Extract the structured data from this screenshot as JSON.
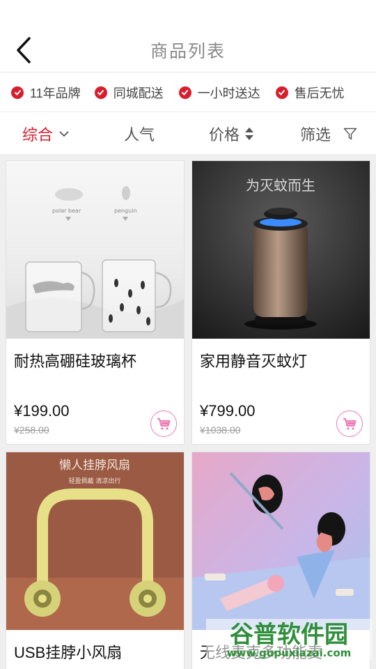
{
  "header": {
    "title": "商品列表"
  },
  "features": [
    "11年品牌",
    "同城配送",
    "一小时送达",
    "售后无忧"
  ],
  "sort": {
    "comprehensive": "综合",
    "popularity": "人气",
    "price": "价格",
    "filter": "筛选"
  },
  "products": [
    {
      "name": "耐热高硼硅玻璃杯",
      "price": "¥199.00",
      "original_price": "¥258.00",
      "image_labels": [
        "polar bear",
        "penguin"
      ]
    },
    {
      "name": "家用静音灭蚊灯",
      "price": "¥799.00",
      "original_price": "¥1038.00",
      "image_labels": [
        "为灭蚊而生"
      ]
    },
    {
      "name": "USB挂脖小风扇",
      "image_labels": [
        "懒人挂脖风扇",
        "轻盈佩戴 清凉出行"
      ]
    },
    {
      "name": "无线麦克多功能麦"
    }
  ],
  "watermark": {
    "name": "谷普软件园",
    "url": "www.gupuxiazai.com"
  },
  "colors": {
    "accent": "#d81e2c",
    "cart": "#f07ab4"
  }
}
